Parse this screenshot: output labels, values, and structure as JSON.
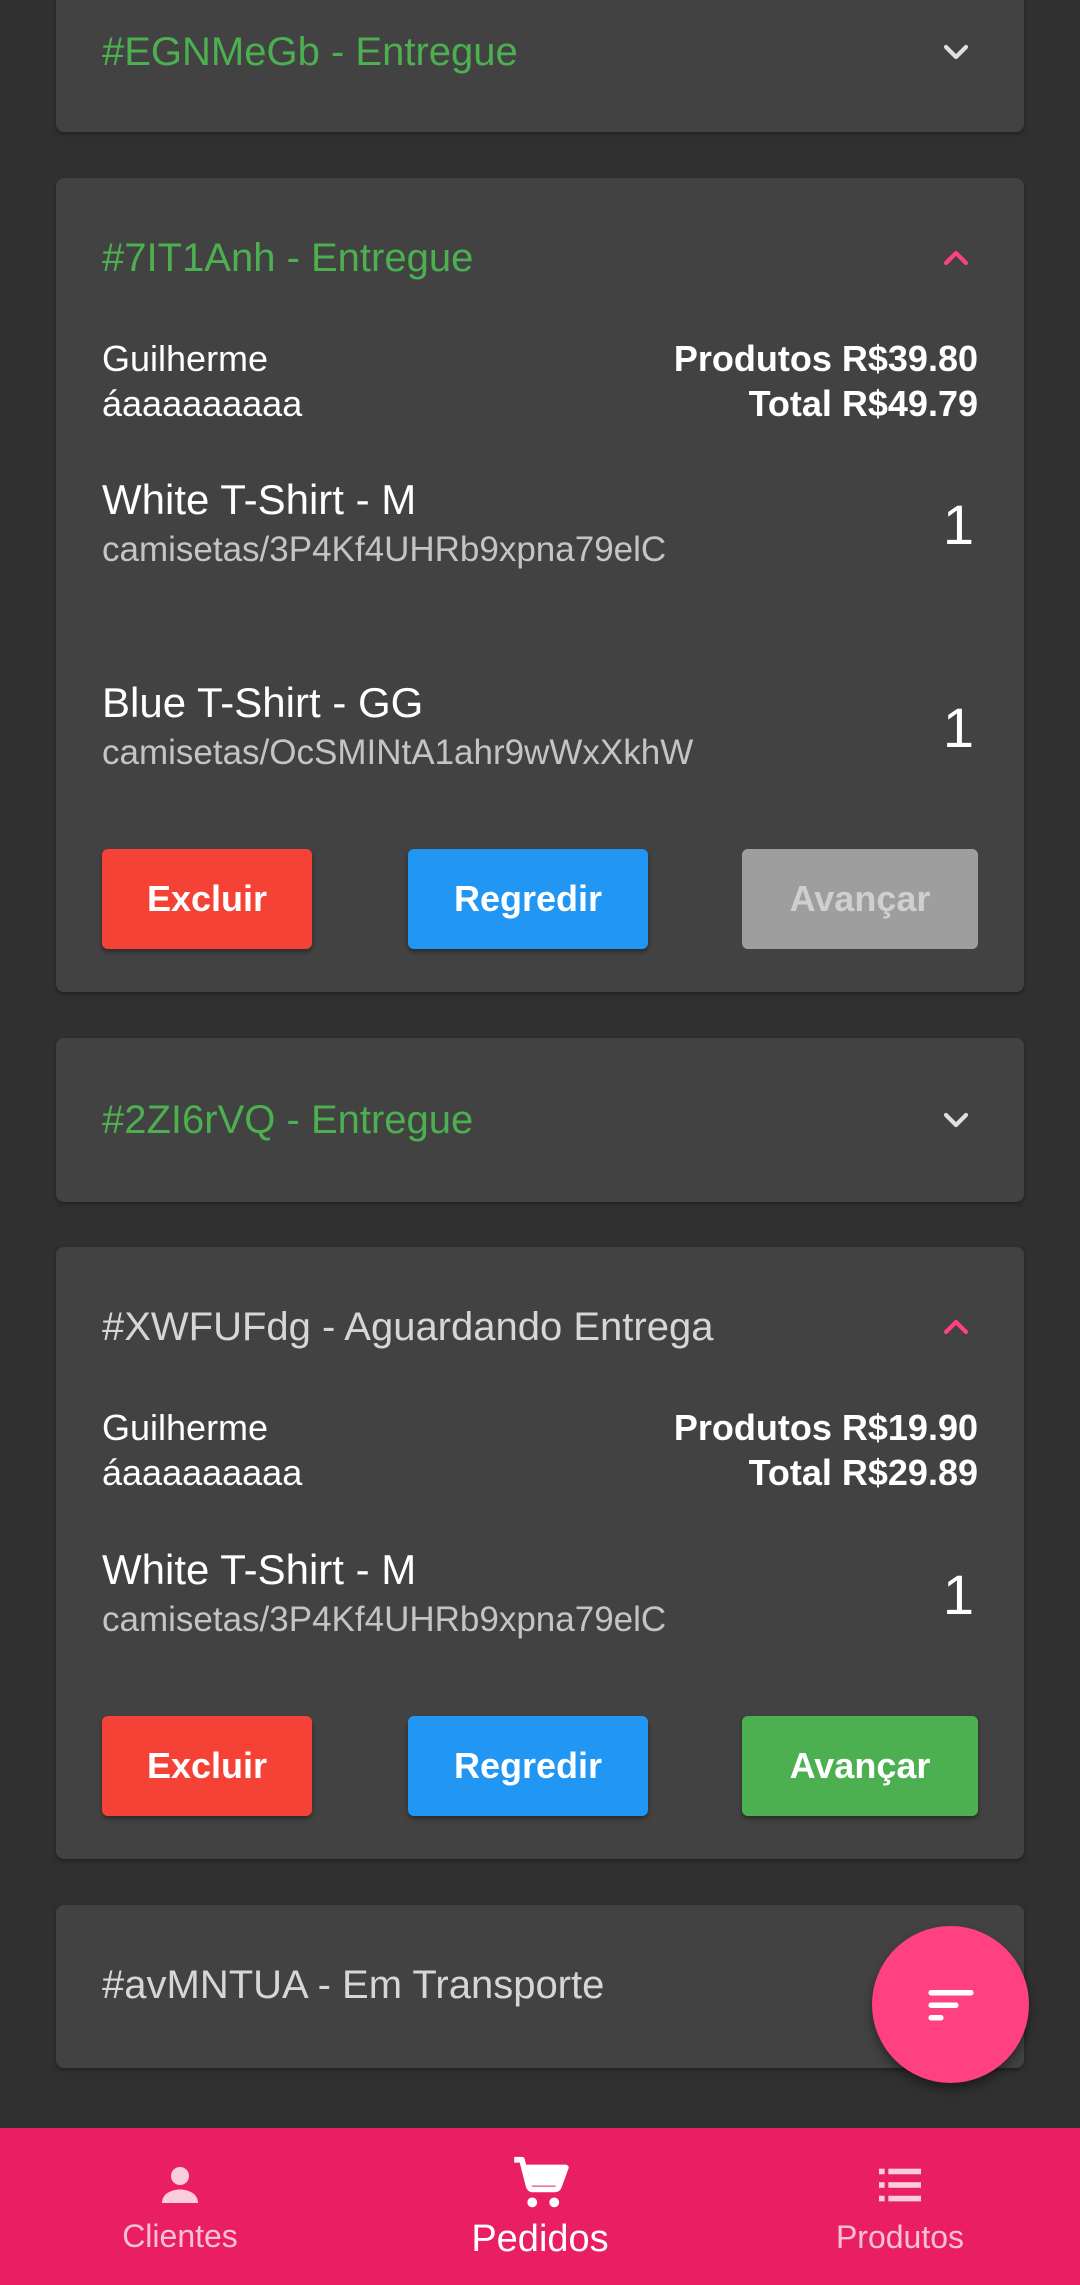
{
  "colors": {
    "background": "#303030",
    "card": "#424242",
    "status_green": "#4caf50",
    "accent_pink": "#ff4081",
    "nav_bar": "#e91e63",
    "delete_red": "#f44336",
    "back_blue": "#2196f3",
    "disabled_grey": "#9e9e9e"
  },
  "orders": [
    {
      "title": "#EGNMeGb - Entregue",
      "expanded": false,
      "chevron_icon": "chevron-down-icon"
    },
    {
      "title": "#7IT1Anh - Entregue",
      "expanded": true,
      "chevron_icon": "chevron-up-icon",
      "customer_first": "Guilherme",
      "customer_second": "áaaaaaaaaa",
      "products_total": "Produtos R$39.80",
      "grand_total": "Total R$49.79",
      "items": [
        {
          "name": "White T-Shirt - M",
          "path": "camisetas/3P4Kf4UHRb9xpna79elC",
          "qty": "1"
        },
        {
          "name": "Blue T-Shirt - GG",
          "path": "camisetas/OcSMINtA1ahr9wWxXkhW",
          "qty": "1"
        }
      ],
      "buttons": {
        "delete": "Excluir",
        "back": "Regredir",
        "advance": "Avançar",
        "advance_enabled": false
      }
    },
    {
      "title": "#2ZI6rVQ - Entregue",
      "expanded": false,
      "chevron_icon": "chevron-down-icon"
    },
    {
      "title": "#XWFUFdg - Aguardando Entrega",
      "expanded": true,
      "chevron_icon": "chevron-up-icon",
      "customer_first": "Guilherme",
      "customer_second": "áaaaaaaaaa",
      "products_total": "Produtos R$19.90",
      "grand_total": "Total R$29.89",
      "items": [
        {
          "name": "White T-Shirt - M",
          "path": "camisetas/3P4Kf4UHRb9xpna79elC",
          "qty": "1"
        }
      ],
      "buttons": {
        "delete": "Excluir",
        "back": "Regredir",
        "advance": "Avançar",
        "advance_enabled": true
      }
    },
    {
      "title": "#avMNTUA - Em Transporte",
      "expanded": false
    }
  ],
  "fab": {
    "icon": "sort-icon"
  },
  "bottom_nav": [
    {
      "label": "Clientes",
      "icon": "person-icon",
      "active": false
    },
    {
      "label": "Pedidos",
      "icon": "cart-icon",
      "active": true
    },
    {
      "label": "Produtos",
      "icon": "list-icon",
      "active": false
    }
  ]
}
